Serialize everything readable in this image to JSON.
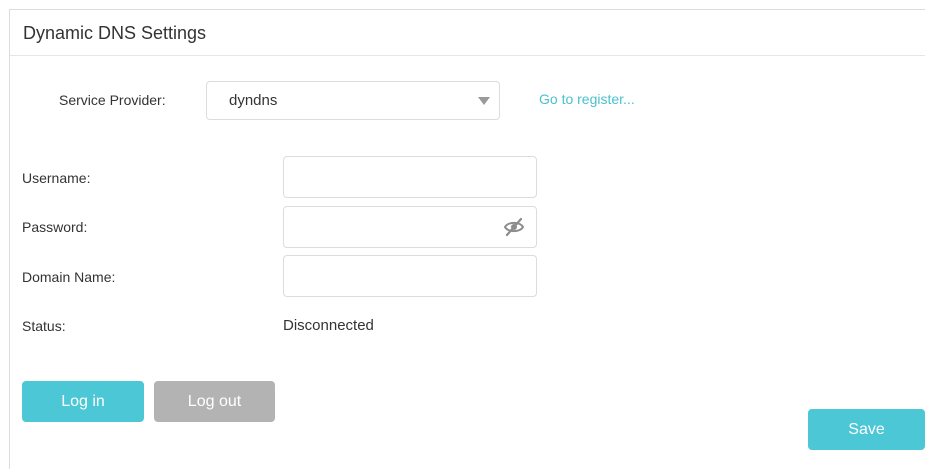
{
  "section": {
    "title": "Dynamic DNS Settings"
  },
  "service_provider": {
    "label": "Service Provider:",
    "selected": "dyndns",
    "register_link": "Go to register..."
  },
  "fields": {
    "username_label": "Username:",
    "username_value": "",
    "password_label": "Password:",
    "password_value": "",
    "domain_label": "Domain Name:",
    "domain_value": ""
  },
  "status": {
    "label": "Status:",
    "value": "Disconnected"
  },
  "buttons": {
    "login": "Log in",
    "logout": "Log out",
    "save": "Save"
  },
  "colors": {
    "accent": "#4bc7d5",
    "link": "#4bc0ce",
    "disabled": "#b3b3b3"
  },
  "icons": {
    "password_toggle": "eye-slash-icon",
    "dropdown": "chevron-down-icon"
  }
}
